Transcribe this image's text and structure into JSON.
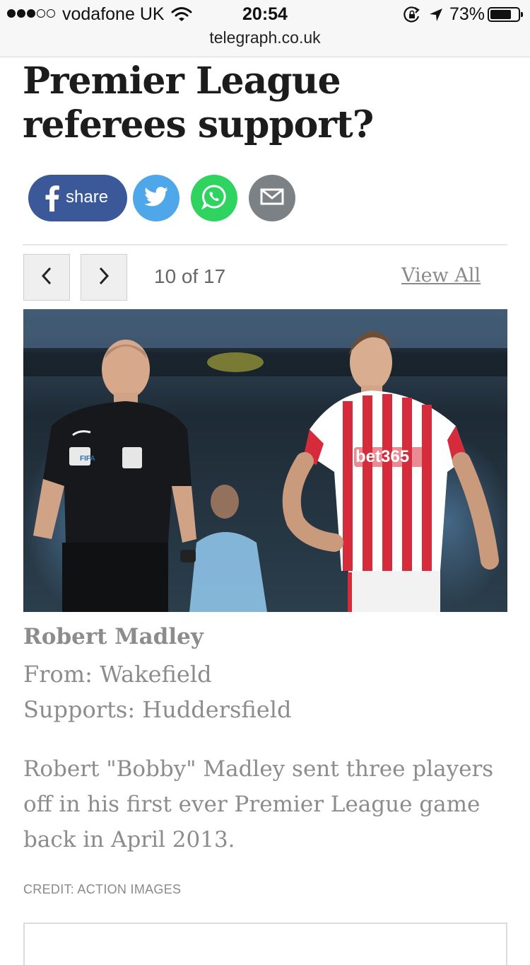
{
  "status_bar": {
    "carrier": "vodafone UK",
    "time": "20:54",
    "battery_percent": "73%",
    "battery_level": 0.73,
    "signal_bars_filled": 3,
    "signal_bars_total": 5
  },
  "browser": {
    "url": "telegraph.co.uk"
  },
  "article": {
    "headline": "Premier League referees support?"
  },
  "share": {
    "facebook_label": "share",
    "facebook_color": "#3b5998",
    "twitter_color": "#4da7e8",
    "whatsapp_color": "#2fd35f",
    "email_color": "#7b8185"
  },
  "gallery": {
    "counter": "10 of 17",
    "view_all": "View All"
  },
  "caption": {
    "name": "Robert Madley",
    "from": "From: Wakefield",
    "supports": "Supports: Huddersfield",
    "body": "Robert \"Bobby\" Madley sent three players off in his first ever Premier League game back in April 2013.",
    "credit": "CREDIT: ACTION IMAGES"
  },
  "photo_text": {
    "fifa_badge": "FIFA",
    "shirt_sponsor": "bet365"
  }
}
